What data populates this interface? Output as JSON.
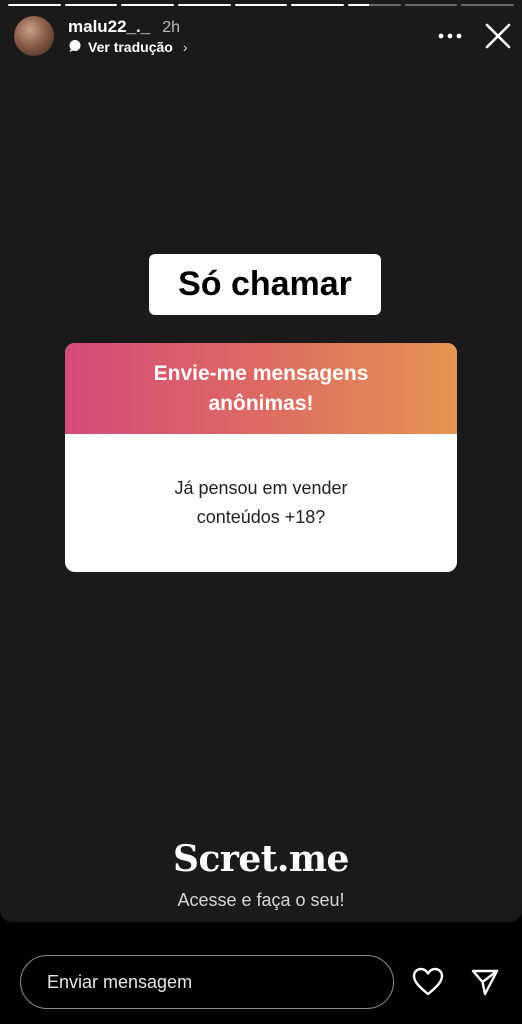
{
  "story": {
    "progress_fractions": [
      1,
      1,
      1,
      1,
      1,
      1,
      0.4,
      0,
      0
    ],
    "username": "malu22_._",
    "time_ago": "2h",
    "translate_label": "Ver tradução",
    "translate_chevron": "›"
  },
  "sticker": {
    "text": "Só chamar"
  },
  "question_card": {
    "header": "Envie-me mensagens anônimas!",
    "question": "Já pensou em vender conteúdos +18?",
    "gradient_colors": [
      "#d44b7a",
      "#dd6a63",
      "#e39550"
    ]
  },
  "brand": {
    "name": "Scret.me",
    "tagline": "Acesse e faça o seu!"
  },
  "bottom_bar": {
    "message_placeholder": "Enviar mensagem"
  },
  "icons": {
    "more": "more-options-icon",
    "close": "close-icon",
    "translate": "speech-bubble-icon",
    "like": "heart-icon",
    "share": "send-icon"
  }
}
